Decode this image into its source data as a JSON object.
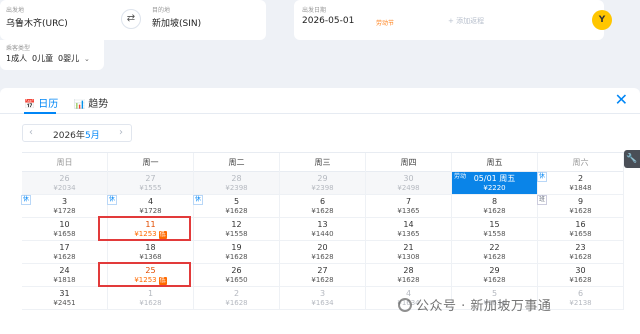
{
  "search": {
    "origin_label": "出发地",
    "origin": "乌鲁木齐(URC)",
    "destination_label": "目的地",
    "destination": "新加坡(SIN)",
    "date_label": "出发日期",
    "date": "2026-05-01",
    "festival": "劳动节",
    "add_trip": "+ 添加返程",
    "pax_label": "乘客类型",
    "adults": "1成人",
    "children": "0儿童",
    "infants": "0婴儿",
    "go_icon": "Y"
  },
  "tabs": [
    {
      "label": "日历",
      "icon": "calendar-icon",
      "glyph": "📅"
    },
    {
      "label": "趋势",
      "icon": "trend-icon",
      "glyph": "📊"
    }
  ],
  "close_glyph": "✕",
  "month_nav": {
    "prev": "‹",
    "year": "2026年",
    "month": "5月",
    "next": "›"
  },
  "weekdays": [
    "周日",
    "周一",
    "周二",
    "周三",
    "周四",
    "周五",
    "周六"
  ],
  "weeks": [
    [
      {
        "day": "26",
        "price": "¥2034",
        "state": "past"
      },
      {
        "day": "27",
        "price": "¥1555",
        "state": "past"
      },
      {
        "day": "28",
        "price": "¥2398",
        "state": "past"
      },
      {
        "day": "29",
        "price": "¥2398",
        "state": "past"
      },
      {
        "day": "30",
        "price": "¥2498",
        "state": "past"
      },
      {
        "day": "05/01 周五",
        "price": "¥2220",
        "state": "selected",
        "tag": "劳动"
      },
      {
        "day": "2",
        "price": "¥1848",
        "rest": "休"
      }
    ],
    [
      {
        "day": "3",
        "price": "¥1728",
        "rest": "休"
      },
      {
        "day": "4",
        "price": "¥1728",
        "rest": "休"
      },
      {
        "day": "5",
        "price": "¥1628",
        "rest": "休"
      },
      {
        "day": "6",
        "price": "¥1628"
      },
      {
        "day": "7",
        "price": "¥1365"
      },
      {
        "day": "8",
        "price": "¥1628"
      },
      {
        "day": "9",
        "price": "¥1628",
        "work": "班"
      }
    ],
    [
      {
        "day": "10",
        "price": "¥1658"
      },
      {
        "day": "11",
        "price": "¥1253",
        "state": "low",
        "tag": "低"
      },
      {
        "day": "12",
        "price": "¥1558"
      },
      {
        "day": "13",
        "price": "¥1440"
      },
      {
        "day": "14",
        "price": "¥1365"
      },
      {
        "day": "15",
        "price": "¥1558"
      },
      {
        "day": "16",
        "price": "¥1658"
      }
    ],
    [
      {
        "day": "17",
        "price": "¥1628"
      },
      {
        "day": "18",
        "price": "¥1368"
      },
      {
        "day": "19",
        "price": "¥1628"
      },
      {
        "day": "20",
        "price": "¥1628"
      },
      {
        "day": "21",
        "price": "¥1308"
      },
      {
        "day": "22",
        "price": "¥1628"
      },
      {
        "day": "23",
        "price": "¥1628"
      }
    ],
    [
      {
        "day": "24",
        "price": "¥1818"
      },
      {
        "day": "25",
        "price": "¥1253",
        "state": "low",
        "tag": "低"
      },
      {
        "day": "26",
        "price": "¥1650"
      },
      {
        "day": "27",
        "price": "¥1628"
      },
      {
        "day": "28",
        "price": "¥1628"
      },
      {
        "day": "29",
        "price": "¥1628"
      },
      {
        "day": "30",
        "price": "¥1628"
      }
    ],
    [
      {
        "day": "31",
        "price": "¥2451"
      },
      {
        "day": "1",
        "price": "¥1628",
        "state": "other"
      },
      {
        "day": "2",
        "price": "¥1628",
        "state": "other"
      },
      {
        "day": "3",
        "price": "¥1634",
        "state": "other"
      },
      {
        "day": "4",
        "price": "¥1634",
        "state": "other"
      },
      {
        "day": "5",
        "price": "¥1634",
        "state": "other"
      },
      {
        "day": "6",
        "price": "¥2138",
        "state": "other"
      }
    ]
  ],
  "tool_glyph": "🔧",
  "watermark": "公众号 · 新加坡万事通",
  "colors": {
    "accent": "#0086f6",
    "low_price": "#ff6a00",
    "highlight_box": "#e23a3a",
    "selected": "#0a84e8"
  }
}
